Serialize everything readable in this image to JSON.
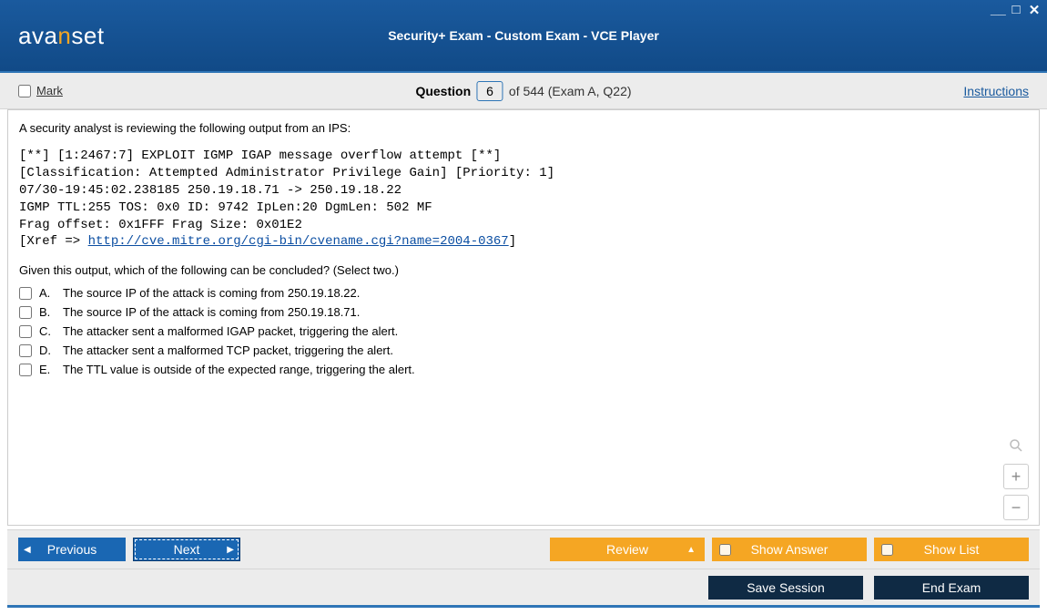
{
  "window": {
    "title": "Security+ Exam - Custom Exam - VCE Player",
    "logo_pre": "ava",
    "logo_n": "n",
    "logo_post": "set"
  },
  "subheader": {
    "mark_label": "Mark",
    "question_label": "Question",
    "question_number": "6",
    "of_text": "of 544 (Exam A, Q22)",
    "instructions": "Instructions"
  },
  "question": {
    "stem": "A security analyst is reviewing the following output from an IPS:",
    "ips_lines": [
      "[**] [1:2467:7] EXPLOIT IGMP IGAP message overflow attempt [**]",
      "[Classification: Attempted Administrator Privilege Gain] [Priority: 1]",
      "07/30-19:45:02.238185 250.19.18.71 -> 250.19.18.22",
      "IGMP TTL:255 TOS: 0x0 ID: 9742 IpLen:20 DgmLen: 502 MF",
      "Frag offset: 0x1FFF Frag Size: 0x01E2"
    ],
    "xref_prefix": "[Xref => ",
    "xref_link": "http://cve.mitre.org/cgi-bin/cvename.cgi?name=2004-0367",
    "xref_suffix": "]",
    "follow": "Given this output, which of the following can be concluded? (Select two.)",
    "options": [
      {
        "letter": "A.",
        "text": "The source IP of the attack is coming from 250.19.18.22."
      },
      {
        "letter": "B.",
        "text": "The source IP of the attack is coming from 250.19.18.71."
      },
      {
        "letter": "C.",
        "text": "The attacker sent a malformed IGAP packet, triggering the alert."
      },
      {
        "letter": "D.",
        "text": "The attacker sent a malformed TCP packet, triggering the alert."
      },
      {
        "letter": "E.",
        "text": "The TTL value is outside of the expected range, triggering the alert."
      }
    ]
  },
  "toolbar": {
    "previous": "Previous",
    "next": "Next",
    "review": "Review",
    "show_answer": "Show Answer",
    "show_list": "Show List",
    "save_session": "Save Session",
    "end_exam": "End Exam"
  }
}
